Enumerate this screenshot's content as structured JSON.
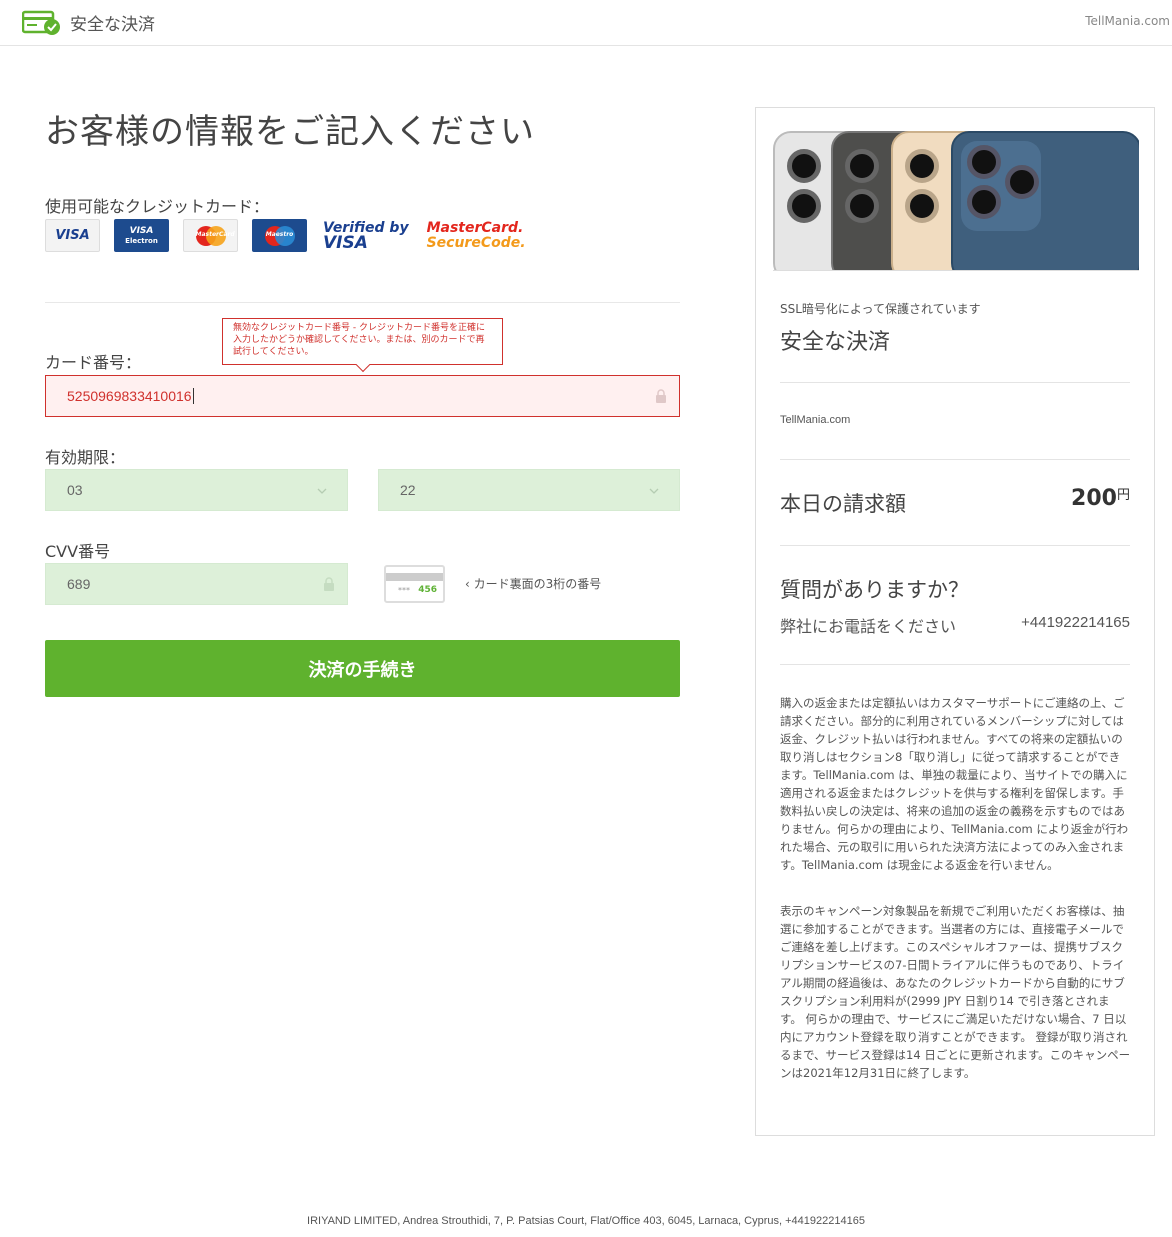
{
  "header": {
    "icon": "secure-card-icon",
    "title": "安全な決済",
    "site": "TellMania.com"
  },
  "form": {
    "title": "お客様の情報をご記入ください",
    "cards_label": "使用可能なクレジットカード：",
    "card_logos": [
      "VISA",
      "VISA Electron",
      "MasterCard",
      "Maestro",
      "Verified by VISA",
      "MasterCard SecureCode"
    ],
    "card_number_label": "カード番号：",
    "card_number_value": "5250969833410016",
    "card_error": "無効なクレジットカード番号 - クレジットカード番号を正確に入力したかどうか確認してください。または、別のカードで再試行してください。",
    "expiry_label": "有効期限：",
    "expiry_month": "03",
    "expiry_year": "22",
    "cvv_label": "CVV番号",
    "cvv_value": "689",
    "cvv_sample": "456",
    "cvv_hint": "カード裏面の3桁の番号",
    "submit_label": "決済の手続き"
  },
  "summary": {
    "ssl_note": "SSL暗号化によって保護されています",
    "title": "安全な決済",
    "merchant": "TellMania.com",
    "total_label": "本日の請求額",
    "total_value": "200",
    "total_currency": "円",
    "question_title": "質問がありますか？",
    "question_sub": "弊社にお電話をください",
    "phone": "+441922214165",
    "terms_1": "購入の返金または定額払いはカスタマーサポートにご連絡の上、ご請求ください。部分的に利用されているメンバーシップに対しては返金、クレジット払いは行われません。すべての将来の定額払いの取り消しはセクション8「取り消し」に従って請求することができます。TellMania.com は、単独の裁量により、当サイトでの購入に適用される返金またはクレジットを供与する権利を留保します。手数料払い戻しの決定は、将来の追加の返金の義務を示すものではありません。何らかの理由により、TellMania.com により返金が行われた場合、元の取引に用いられた決済方法によってのみ入金されます。TellMania.com は現金による返金を行いません。",
    "terms_2": "表示のキャンペーン対象製品を新規でご利用いただくお客様は、抽選に参加することができます。当選者の方には、直接電子メールでご連絡を差し上げます。このスペシャルオファーは、提携サブスクリプションサービスの7-日間トライアルに伴うものであり、トライアル期間の経過後は、あなたのクレジットカードから自動的にサブスクリプション利用料が(2999 JPY 日割り14 で引き落とされます。 何らかの理由で、サービスにご満足いただけない場合、7 日以内にアカウント登録を取り消すことができます。 登録が取り消されるまで、サービス登録は14 日ごとに更新されます。このキャンペーンは2021年12月31日に終了します。"
  },
  "footer": {
    "text": "IRIYAND LIMITED, Andrea Strouthidi, 7, P. Patsias Court, Flat/Office 403, 6045, Larnaca, Cyprus, +441922214165"
  },
  "colors": {
    "accent_green": "#5fb22e",
    "error_red": "#d0312d",
    "valid_bg": "#ddf0d9"
  }
}
